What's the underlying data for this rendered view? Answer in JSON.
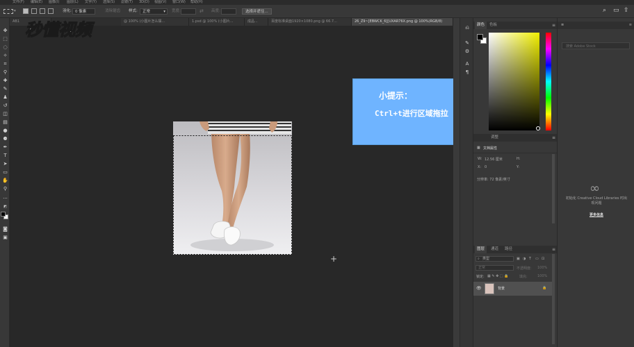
{
  "menu": [
    "文件(F)",
    "编辑(E)",
    "图像(I)",
    "图层(L)",
    "文字(Y)",
    "选择(S)",
    "滤镜(T)",
    "3D(D)",
    "视图(V)",
    "窗口(W)",
    "帮助(H)"
  ],
  "options": {
    "feather_label": "羽化:",
    "feather_value": "0 像素",
    "antialias_label": "消除锯齿",
    "style_label": "样式:",
    "style_value": "正常",
    "width_label": "宽度:",
    "height_label": "高度:",
    "select_mask_button": "选择并遮住..."
  },
  "tabs": [
    {
      "label": "AB1"
    },
    {
      "label": "@ 100% (小图片怎么摆..."
    },
    {
      "label": "1.psd @ 100% (小图片..."
    },
    {
      "label": "成品..."
    },
    {
      "label": "百度标准桌面1920×1080.png @ 66.7..."
    },
    {
      "label": "26_Z9~[EBWCK_6][UXAR76X.png @ 100%(RGB/8)"
    }
  ],
  "watermark": "秒懂视频",
  "tip": {
    "title": "小提示：",
    "body": "Ctrl+t进行区域拖拉"
  },
  "color_panel": {
    "tabs": [
      "颜色",
      "色板"
    ],
    "fg_color": "#000000",
    "bg_color": "#ffffff",
    "hue_color": "#f1ef00"
  },
  "properties_panel": {
    "tabs": [
      "调整"
    ],
    "title": "文档属性",
    "w_label": "W:",
    "w_value": "12.56 厘米",
    "h_label": "H:",
    "x_label": "X:",
    "x_value": "0",
    "y_label": "Y:",
    "resolution": "分辨率: 72 像素/英寸"
  },
  "layers_panel": {
    "tabs": [
      "图层",
      "通道",
      "路径"
    ],
    "kind_label": "类型",
    "blend_mode": "正常",
    "opacity_label": "不透明度:",
    "opacity_value": "100%",
    "lock_label": "锁定:",
    "fill_label": "填充:",
    "fill_value": "100%",
    "layer_name": "背景"
  },
  "libraries_panel": {
    "search_placeholder": "搜索 Adobe Stock",
    "message": "初始化 Creative Cloud Libraries 时出现问题",
    "more_info_link": "更多信息"
  }
}
